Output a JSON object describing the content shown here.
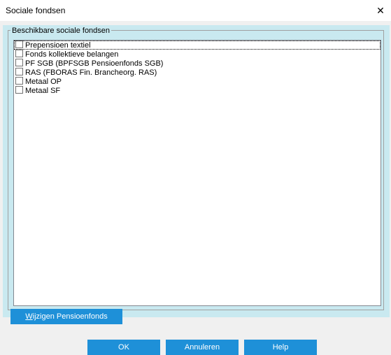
{
  "window": {
    "title": "Sociale fondsen",
    "close_glyph": "✕"
  },
  "group": {
    "label": "Beschikbare sociale fondsen"
  },
  "list": {
    "items": [
      {
        "label": "Prepensioen textiel",
        "checked": false,
        "focused": true
      },
      {
        "label": "Fonds kollektieve belangen",
        "checked": false
      },
      {
        "label": "PF SGB (BPFSGB Pensioenfonds SGB)",
        "checked": false
      },
      {
        "label": "RAS (FBORAS Fin. Brancheorg. RAS)",
        "checked": false
      },
      {
        "label": "Metaal OP",
        "checked": false
      },
      {
        "label": "Metaal SF",
        "checked": false
      }
    ]
  },
  "buttons": {
    "wijzigen_mnemonic": "W",
    "wijzigen_rest": "ijzigen Pensioenfonds",
    "ok": "OK",
    "annuleren": "Annuleren",
    "help": "Help"
  },
  "colors": {
    "panel_bg": "#c9e9f0",
    "button_bg": "#1e90d8",
    "dialog_bg": "#f0f0f0"
  }
}
